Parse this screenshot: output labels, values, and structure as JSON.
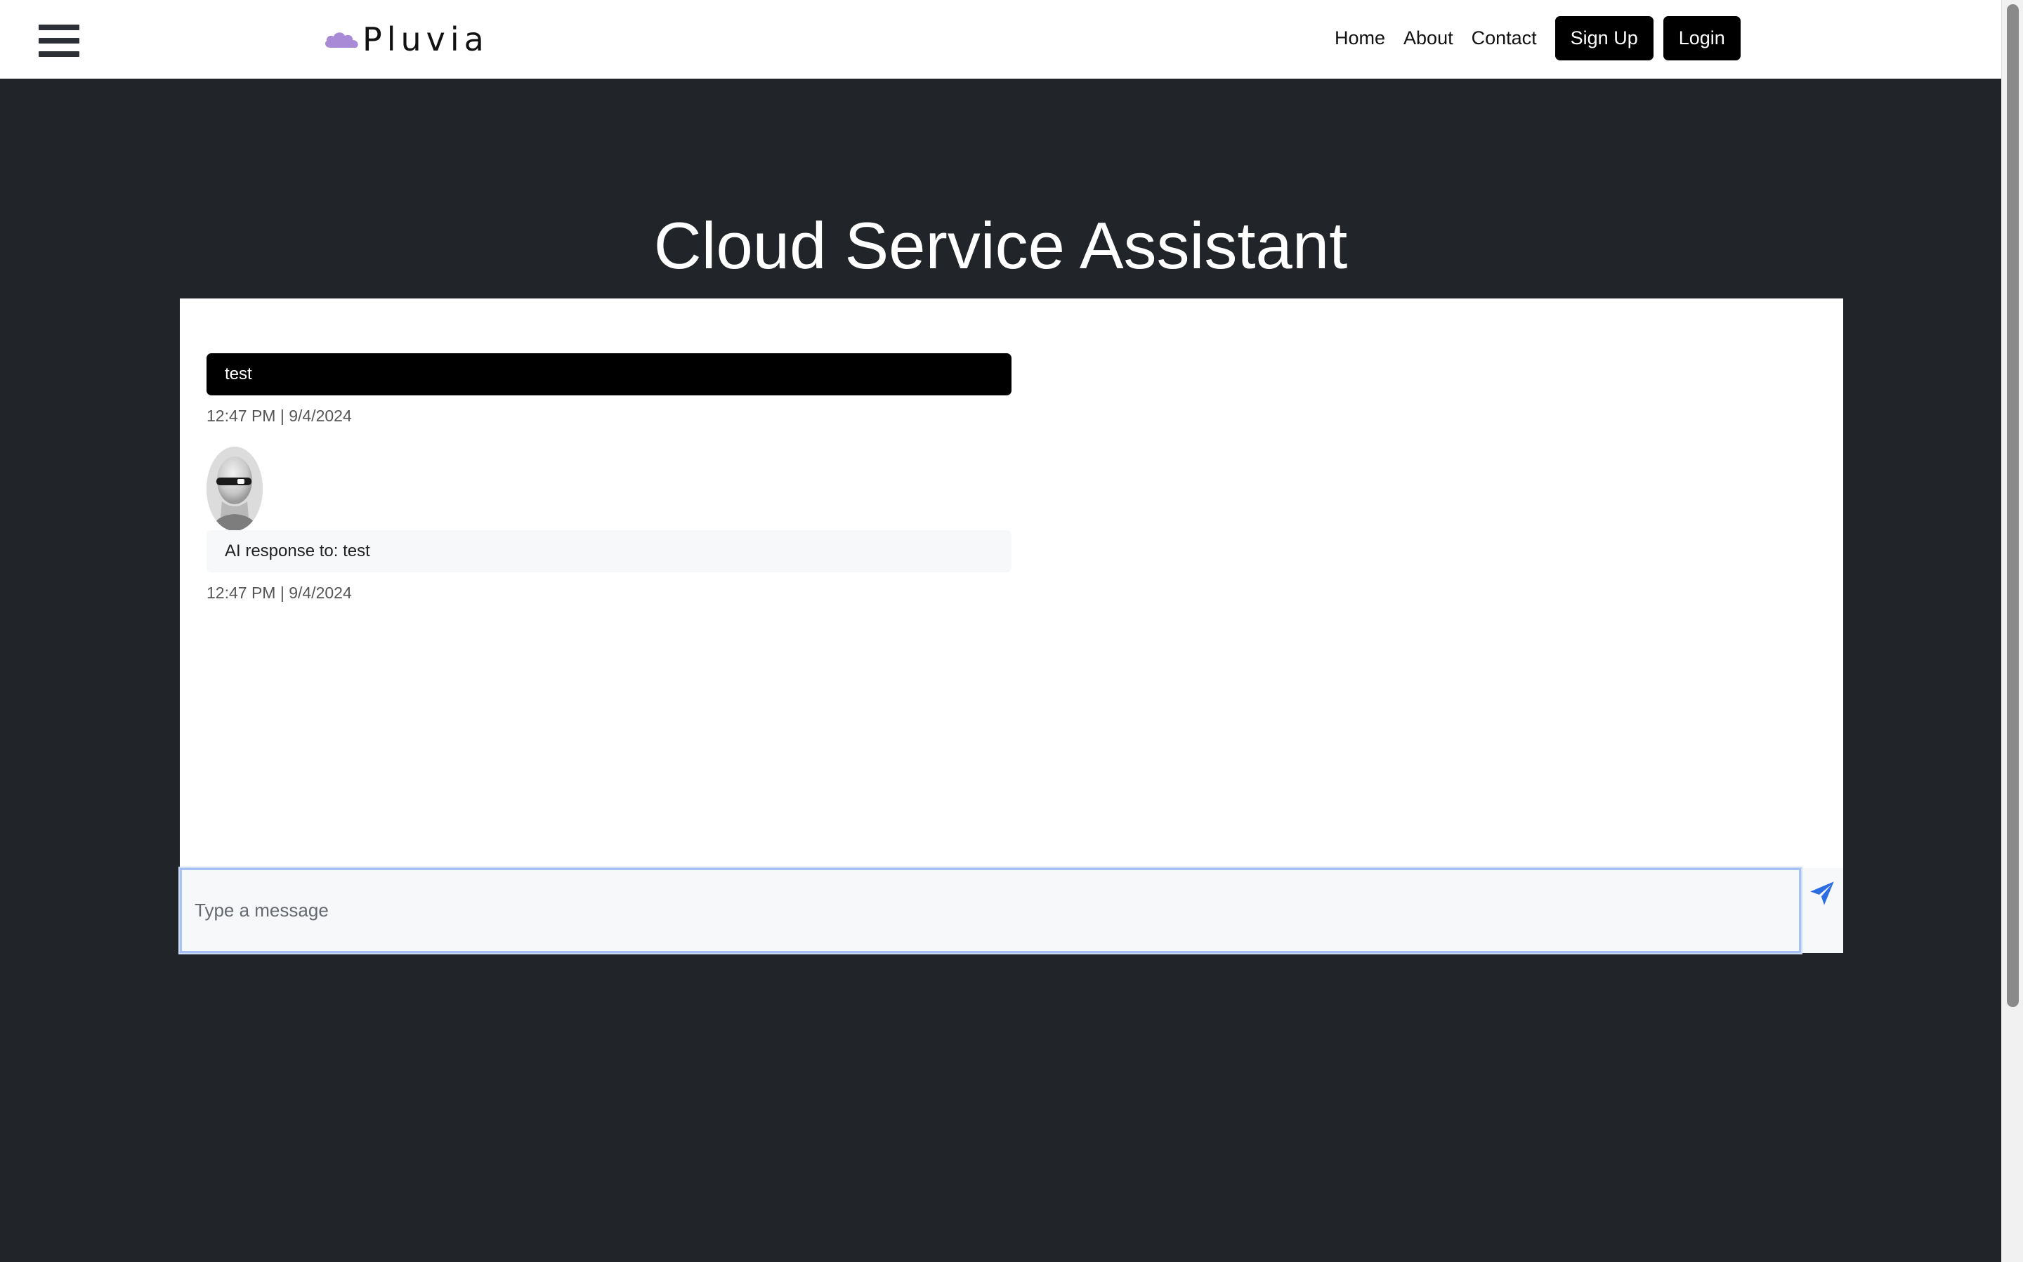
{
  "header": {
    "brand_name": "Pluvia",
    "nav": {
      "home": "Home",
      "about": "About",
      "contact": "Contact",
      "signup": "Sign Up",
      "login": "Login"
    },
    "brand_color": "#a98ad6"
  },
  "main": {
    "title": "Cloud Service Assistant"
  },
  "chat": {
    "messages": [
      {
        "role": "user",
        "text": "test",
        "time": "12:47 PM | 9/4/2024"
      },
      {
        "role": "assistant",
        "text": "AI response to: test",
        "time": "12:47 PM | 9/4/2024"
      }
    ],
    "input": {
      "placeholder": "Type a message",
      "value": ""
    },
    "send_icon": "paper-plane-icon",
    "accent_color": "#2b6de3"
  },
  "icons": {
    "menu": "hamburger-menu-icon",
    "brand": "cloud-icon",
    "avatar": "robot-avatar"
  }
}
